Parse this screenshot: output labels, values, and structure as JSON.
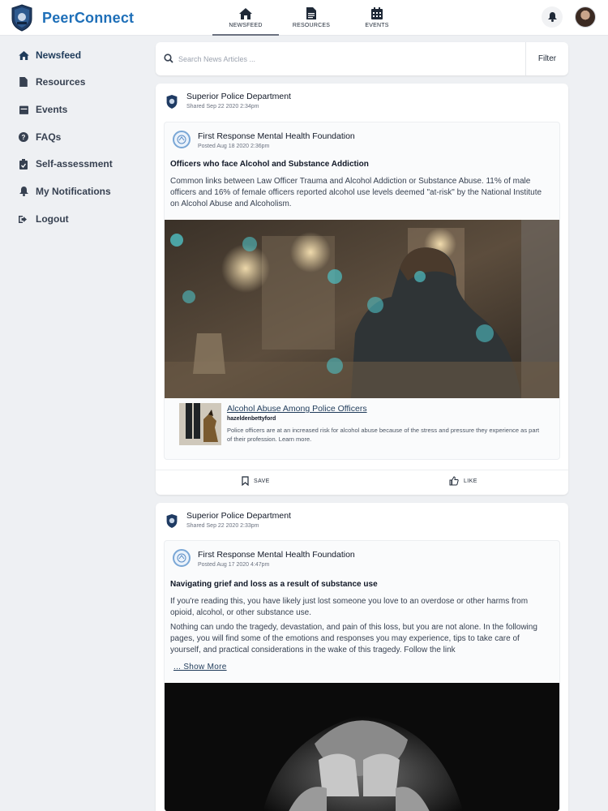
{
  "app": {
    "brand": "PeerConnect",
    "accent_color": "#1e6fb8"
  },
  "topnav": {
    "items": [
      {
        "label": "NEWSFEED",
        "icon": "home-icon",
        "active": true
      },
      {
        "label": "RESOURCES",
        "icon": "document-icon",
        "active": false
      },
      {
        "label": "EVENTS",
        "icon": "calendar-icon",
        "active": false
      }
    ]
  },
  "header": {
    "bell_icon": "bell-icon",
    "avatar": "user-avatar"
  },
  "sidebar": {
    "items": [
      {
        "label": "Newsfeed",
        "icon": "home-icon",
        "active": true
      },
      {
        "label": "Resources",
        "icon": "document-icon"
      },
      {
        "label": "Events",
        "icon": "calendar-icon"
      },
      {
        "label": "FAQs",
        "icon": "question-circle-icon"
      },
      {
        "label": "Self-assessment",
        "icon": "clipboard-icon"
      },
      {
        "label": "My Notifications",
        "icon": "bell-icon"
      },
      {
        "label": "Logout",
        "icon": "logout-icon"
      }
    ]
  },
  "search": {
    "placeholder": "Search News Articles ...",
    "value": "",
    "filter_label": "Filter"
  },
  "posts": [
    {
      "sharer": "Superior Police Department",
      "shared_date": "Shared Sep 22 2020 2:34pm",
      "org": "First Response Mental Health Foundation",
      "posted_date": "Posted Aug 18 2020 2:36pm",
      "title": "Officers who face Alcohol and Substance Addiction",
      "body": "Common links between Law Officer Trauma and Alcohol Addiction or Substance Abuse. 11% of male officers and 16% of female officers reported alcohol use levels deemed \"at-risk\" by the National Institute on Alcohol Abuse and Alcoholism.",
      "link": {
        "title": "Alcohol Abuse Among Police Officers",
        "source": "hazeldenbettyford",
        "description": "Police officers are at an increased risk for alcohol abuse because of the stress and pressure they experience as part of their profession. Learn more."
      },
      "save_label": "SAVE",
      "like_label": "LIKE"
    },
    {
      "sharer": "Superior Police Department",
      "shared_date": "Shared Sep 22 2020 2:33pm",
      "org": "First Response Mental Health Foundation",
      "posted_date": "Posted Aug 17 2020 4:47pm",
      "title": "Navigating grief and loss as a result of substance use",
      "body1": "If you're reading this, you have likely just lost someone you love to an overdose or other harms from opioid, alcohol, or other substance use.",
      "body2": "Nothing can undo the tragedy, devastation, and pain of this loss, but you are not alone. In the following pages, you will find some of the emotions and responses you may experience, tips to take care of yourself, and practical considerations in the wake of this tragedy. Follow the link",
      "show_more": "... Show More"
    }
  ]
}
